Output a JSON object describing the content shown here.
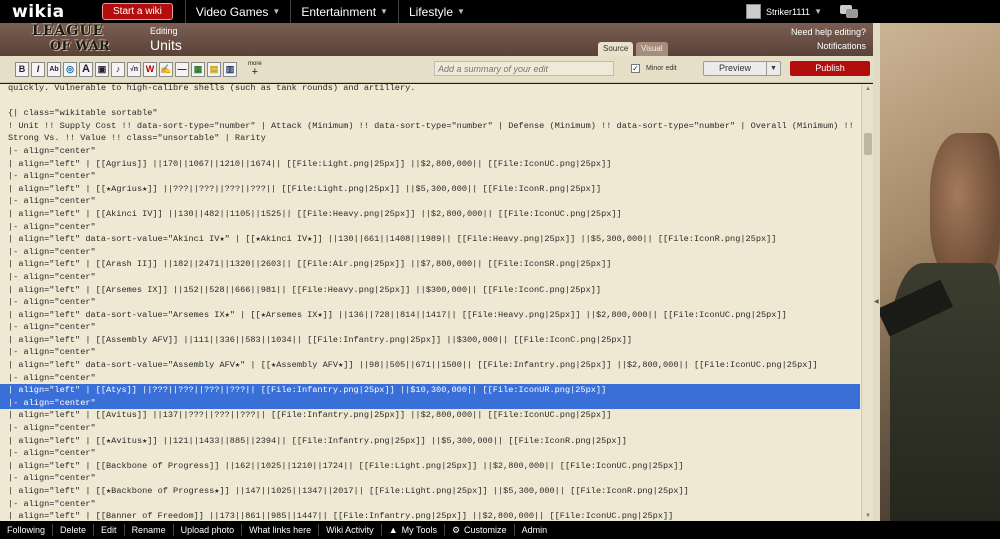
{
  "topbar": {
    "logo": "wikia",
    "start_wiki": "Start a wiki",
    "nav": [
      {
        "label": "Video Games"
      },
      {
        "label": "Entertainment"
      },
      {
        "label": "Lifestyle"
      }
    ],
    "username": "Striker1111"
  },
  "header": {
    "wiki_logo_line1": "LEAGUE",
    "wiki_logo_line2": "OF WAR",
    "editing_label": "Editing",
    "page_name": "Units",
    "tab_source": "Source",
    "tab_visual": "Visual",
    "help": "Need help editing?",
    "notifications": "Notifications"
  },
  "toolbar": {
    "more_label": "more",
    "more_plus": "+",
    "summary_placeholder": "Add a summary of your edit",
    "minor_edit_label": "Minor edit",
    "minor_checked": "✓",
    "preview_label": "Preview",
    "publish_label": "Publish"
  },
  "editor": {
    "lines": [
      "quickly. Vulnerable to high-calibre shells (such as tank rounds) and artillery.",
      "",
      "{| class=\"wikitable sortable\"",
      "! Unit !! Supply Cost !! data-sort-type=\"number\" | Attack (Minimum) !! data-sort-type=\"number\" | Defense (Minimum) !! data-sort-type=\"number\" | Overall (Minimum) !!",
      "Strong Vs. !! Value !! class=\"unsortable\" | Rarity",
      "|- align=\"center\"",
      "| align=\"left\" | [[Agrius]] ||170||1067||1210||1674|| [[File:Light.png|25px]] ||$2,800,000|| [[File:IconUC.png|25px]]",
      "|- align=\"center\"",
      "| align=\"left\" | [[★Agrius★]] ||???||???||???||???|| [[File:Light.png|25px]] ||$5,300,000|| [[File:IconR.png|25px]]",
      "|- align=\"center\"",
      "| align=\"left\" | [[Akinci IV]] ||130||482||1105||1525|| [[File:Heavy.png|25px]] ||$2,800,000|| [[File:IconUC.png|25px]]",
      "|- align=\"center\"",
      "| align=\"left\" data-sort-value=\"Akinci IV★\" | [[★Akinci IV★]] ||130||661||1408||1989|| [[File:Heavy.png|25px]] ||$5,300,000|| [[File:IconR.png|25px]]",
      "|- align=\"center\"",
      "| align=\"left\" | [[Arash II]] ||182||2471||1320||2603|| [[File:Air.png|25px]] ||$7,800,000|| [[File:IconSR.png|25px]]",
      "|- align=\"center\"",
      "| align=\"left\" | [[Arsemes IX]] ||152||528||666||981|| [[File:Heavy.png|25px]] ||$300,000|| [[File:IconC.png|25px]]",
      "|- align=\"center\"",
      "| align=\"left\" data-sort-value=\"Arsemes IX★\" | [[★Arsemes IX★]] ||136||728||814||1417|| [[File:Heavy.png|25px]] ||$2,800,000|| [[File:IconUC.png|25px]]",
      "|- align=\"center\"",
      "| align=\"left\" | [[Assembly AFV]] ||111||336||583||1034|| [[File:Infantry.png|25px]] ||$300,000|| [[File:IconC.png|25px]]",
      "|- align=\"center\"",
      "| align=\"left\" data-sort-value=\"Assembly AFV★\" | [[★Assembly AFV★]] ||98||505||671||1500|| [[File:Infantry.png|25px]] ||$2,800,000|| [[File:IconUC.png|25px]]",
      "|- align=\"center\"",
      "| align=\"left\" | [[Atys]] ||???||???||???||???|| [[File:Infantry.png|25px]] ||$10,300,000|| [[File:IconUR.png|25px]]",
      "|- align=\"center\"",
      "| align=\"left\" | [[Avitus]] ||137||???||???||???|| [[File:Infantry.png|25px]] ||$2,800,000|| [[File:IconUC.png|25px]]",
      "|- align=\"center\"",
      "| align=\"left\" | [[★Avitus★]] ||121||1433||885||2394|| [[File:Infantry.png|25px]] ||$5,300,000|| [[File:IconR.png|25px]]",
      "|- align=\"center\"",
      "| align=\"left\" | [[Backbone of Progress]] ||162||1025||1210||1724|| [[File:Light.png|25px]] ||$2,800,000|| [[File:IconUC.png|25px]]",
      "|- align=\"center\"",
      "| align=\"left\" | [[★Backbone of Progress★]] ||147||1025||1347||2017|| [[File:Light.png|25px]] ||$5,300,000|| [[File:IconR.png|25px]]",
      "|- align=\"center\"",
      "| align=\"left\" | [[Banner of Freedom]] ||173||861||985||1447|| [[File:Infantry.png|25px]] ||$2,800,000|| [[File:IconUC.png|25px]]"
    ]
  },
  "bottombar": {
    "items": [
      {
        "label": "Following"
      },
      {
        "label": "Delete"
      },
      {
        "label": "Edit"
      },
      {
        "label": "Rename"
      },
      {
        "label": "Upload photo"
      },
      {
        "label": "What links here"
      },
      {
        "label": "Wiki Activity"
      },
      {
        "label": "My Tools"
      },
      {
        "label": "Customize"
      },
      {
        "label": "Admin"
      }
    ]
  },
  "colors": {
    "brand_red": "#b40d0d",
    "selection": "#3a6fd8"
  }
}
